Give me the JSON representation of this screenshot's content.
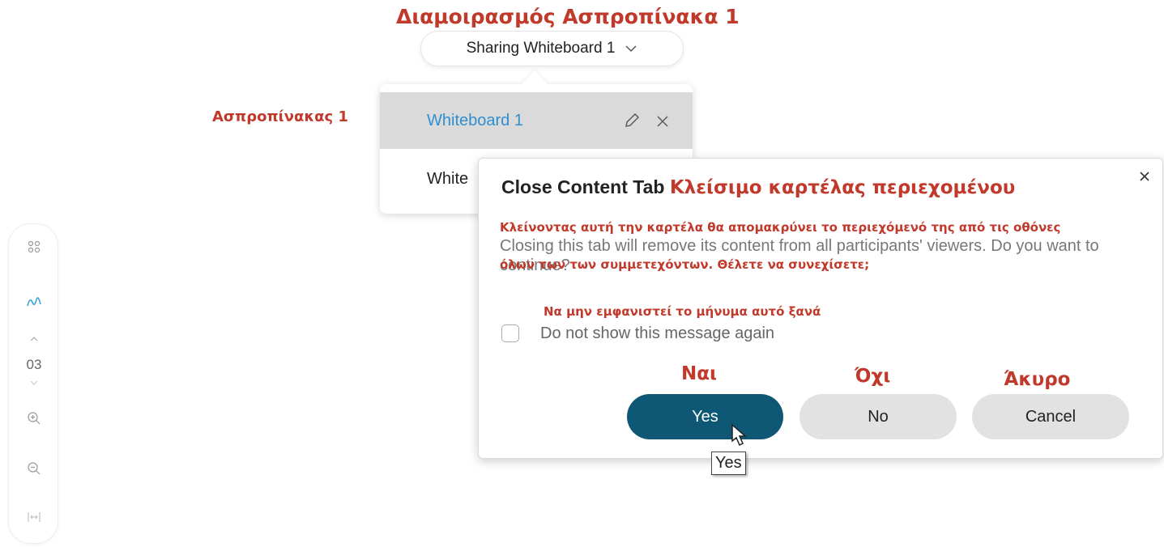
{
  "annotations": {
    "sharing_gr": "Διαμοιρασμός Ασπροπίνακα 1",
    "whiteboard1_gr": "Ασπροπίνακας 1",
    "title_gr": "Κλείσιμο καρτέλας περιεχομένου",
    "body_gr_line1": "Κλείνοντας αυτή την καρτέλα θα απομακρύνει το περιεχόμενό της από τις οθόνες",
    "body_gr_line2": "όλων των των συμμετεχόντων. Θέλετε να συνεχίσετε;",
    "checkbox_gr": "Να μην εμφανιστεί το μήνυμα αυτό ξανά",
    "yes_gr": "Ναι",
    "no_gr": "Όχι",
    "cancel_gr": "Άκυρο"
  },
  "sharing": {
    "label": "Sharing Whiteboard 1"
  },
  "dropdown": {
    "items": [
      {
        "label": "Whiteboard 1",
        "active": true
      },
      {
        "label": "White",
        "active": false
      }
    ]
  },
  "toolbar": {
    "icons": [
      "grid-icon",
      "pen-icon",
      "chevron-up-icon",
      "chevron-down-icon",
      "zoom-in-icon",
      "zoom-out-icon",
      "fit-width-icon"
    ],
    "page": "03"
  },
  "dialog": {
    "title": "Close Content Tab",
    "body": "Closing this tab will remove its content from all participants' viewers. Do you want to continue?",
    "checkbox_label": "Do not show this message again",
    "checkbox_checked": false,
    "yes_label": "Yes",
    "no_label": "No",
    "cancel_label": "Cancel",
    "accent_color": "#0e5876"
  },
  "tooltip": {
    "text": "Yes"
  }
}
